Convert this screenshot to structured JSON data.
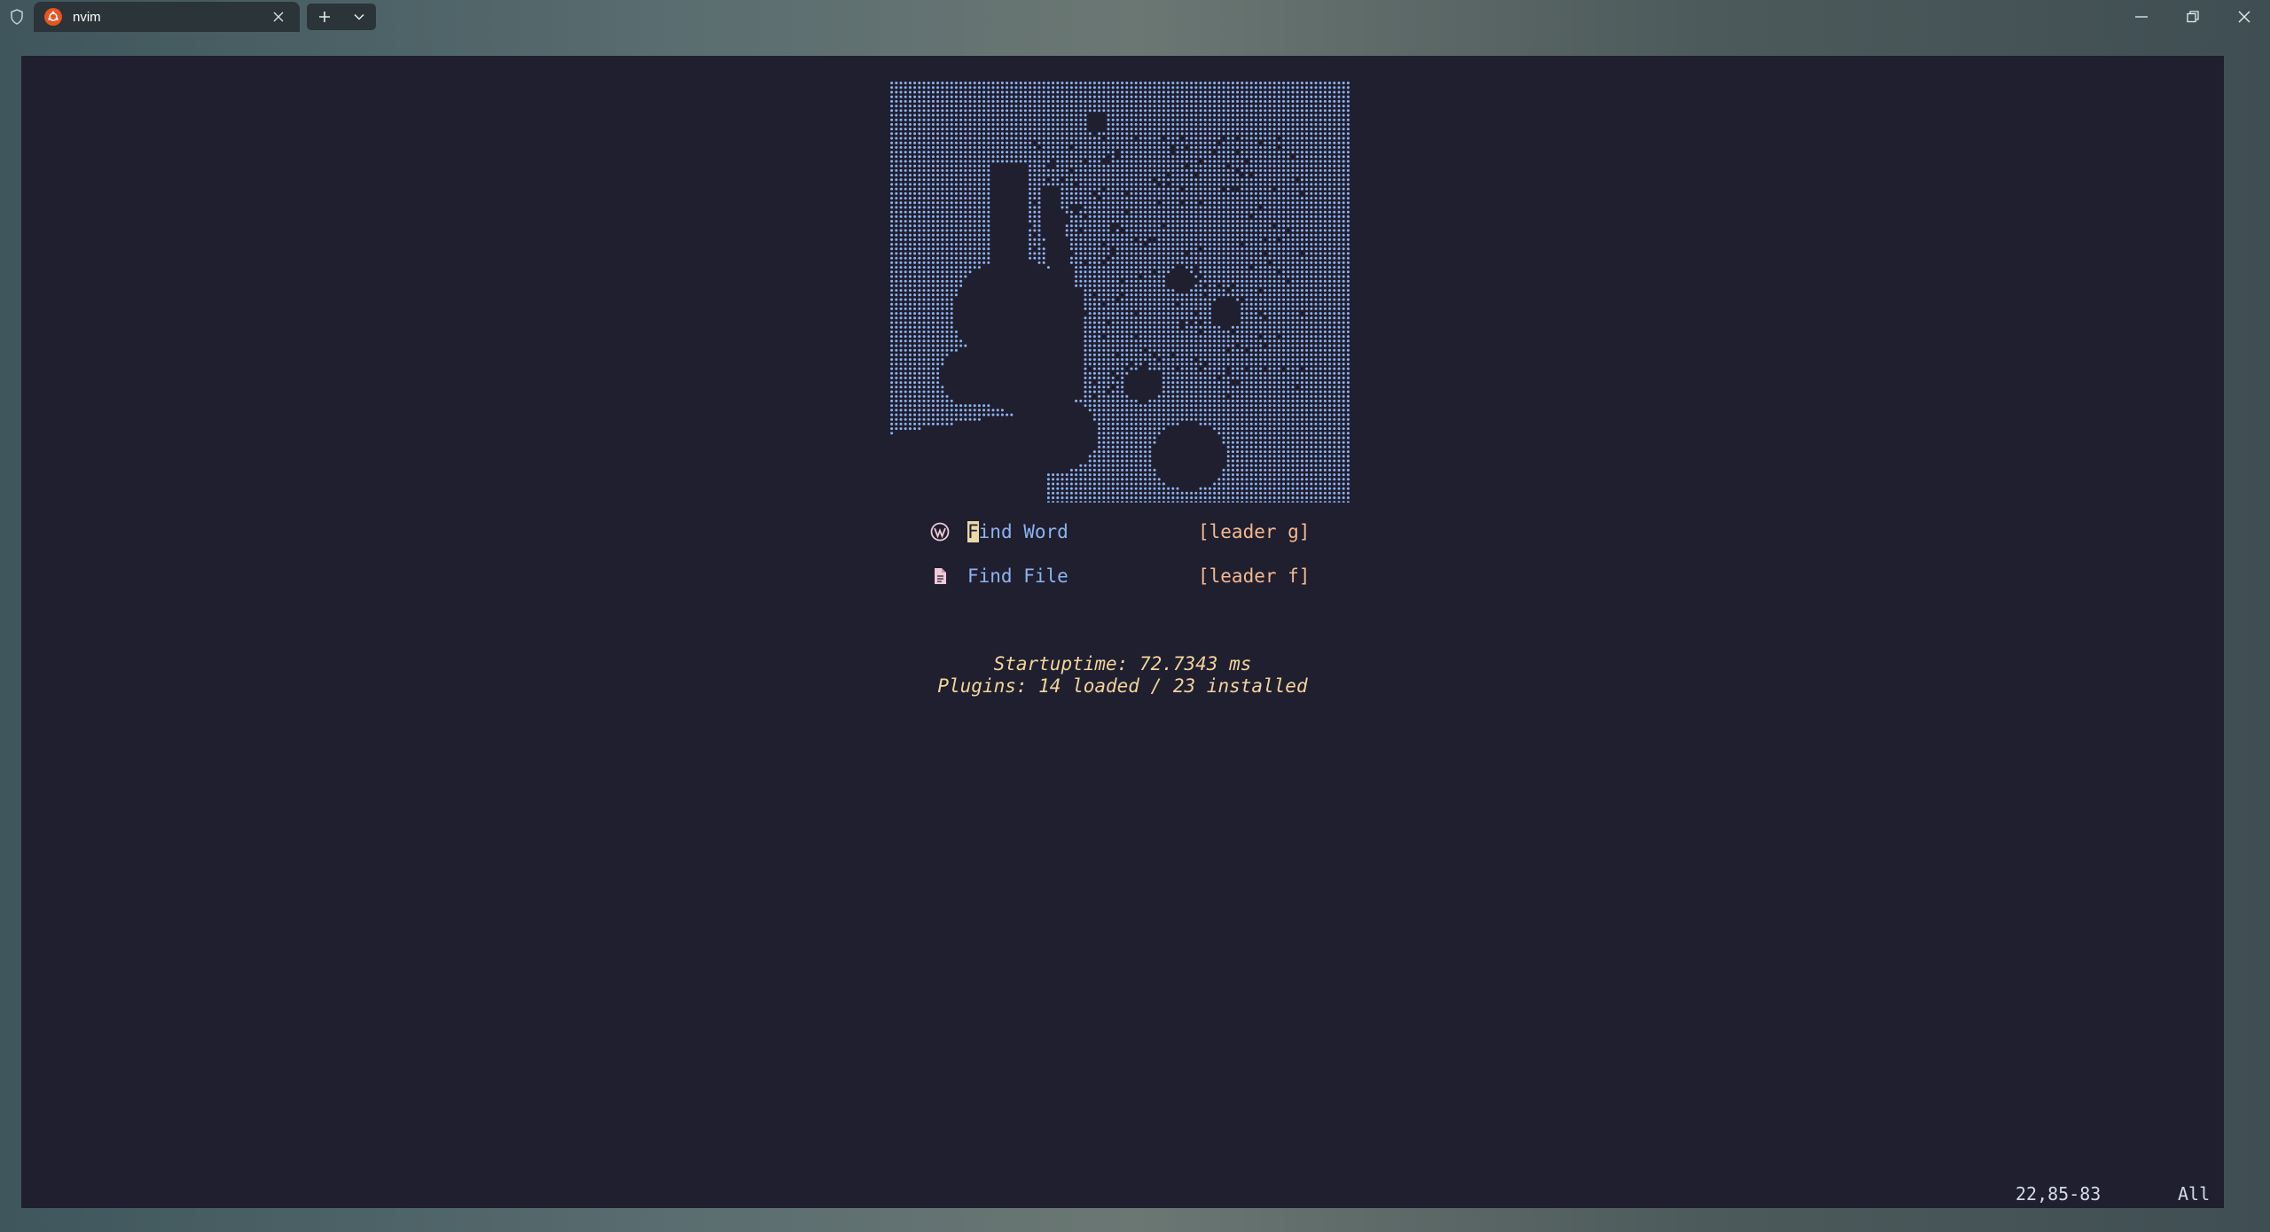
{
  "window": {
    "tab_title": "nvim",
    "icons": {
      "shield": "shield-icon",
      "tab_app": "ubuntu-icon",
      "tab_close": "close-icon",
      "new_tab": "plus-icon",
      "tab_dropdown": "chevron-down-icon",
      "minimize": "minimize-icon",
      "maximize": "restore-icon",
      "close": "close-icon"
    }
  },
  "dashboard": {
    "header_art": "ascii-art-portrait",
    "menu": [
      {
        "icon": "wordpress-icon",
        "first_char": "F",
        "label_rest": "ind Word",
        "key": "[leader g]"
      },
      {
        "icon": "file-icon",
        "label": "Find File",
        "key": "[leader f]"
      }
    ],
    "footer": {
      "startuptime": "Startuptime: 72.7343 ms",
      "plugins": "Plugins: 14 loaded / 23 installed"
    }
  },
  "statusline": {
    "position": "22,85-83",
    "scroll": "All"
  },
  "colors": {
    "terminal_bg": "#1f1f2f",
    "art": "#8fb3f0",
    "label": "#8fb3f0",
    "key": "#f5b88f",
    "footer": "#f3d49b",
    "tab_accent": "#e95420"
  }
}
